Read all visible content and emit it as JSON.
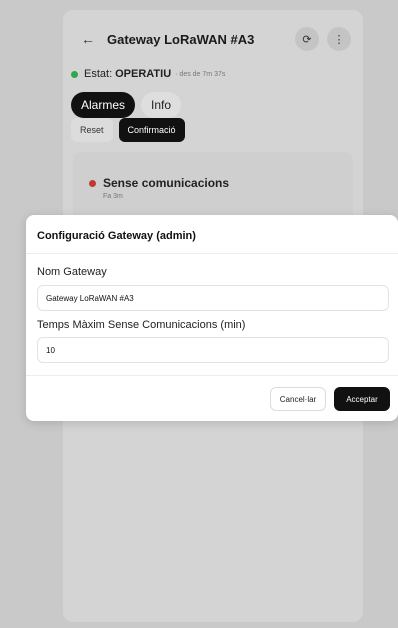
{
  "app": {
    "title": "Gateway LoRaWAN #A3",
    "back_icon": "←",
    "refresh_icon": "⟳",
    "more_icon": "⋮"
  },
  "status": {
    "label": "Estat:",
    "value": "OPERATIU",
    "since": "· des de 7m 37s",
    "color": "#2fa84f"
  },
  "tabs": [
    {
      "label": "Alarmes",
      "active": true
    },
    {
      "label": "Info",
      "active": false
    }
  ],
  "actions": {
    "reset": "Reset",
    "confirm": "Confirmació"
  },
  "alarm": {
    "title": "Sense comunicacions",
    "time": "Fa 3m",
    "color": "#c0392b"
  },
  "modal": {
    "title": "Configuració Gateway (admin)",
    "name_label": "Nom Gateway",
    "name_value": "Gateway LoRaWAN #A3",
    "timeout_label": "Temps Màxim Sense Comunicacions (min)",
    "timeout_value": "10",
    "cancel": "Cancel·lar",
    "accept": "Acceptar"
  }
}
